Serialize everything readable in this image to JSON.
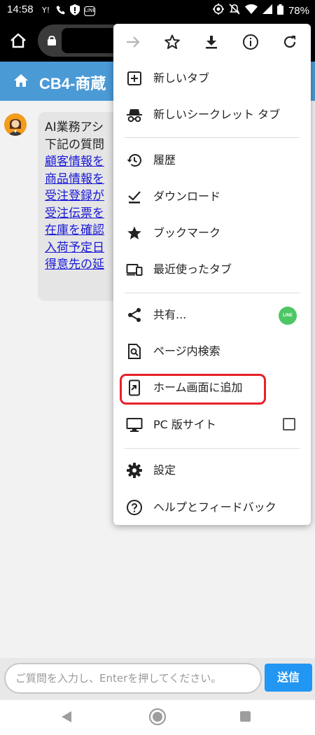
{
  "status_bar": {
    "time": "14:58",
    "left_icons": [
      "carrier-icon",
      "call-icon",
      "shield-alert-icon",
      "line-notification-icon"
    ],
    "right_icons": [
      "location-sync-icon",
      "mute-icon",
      "wifi-icon",
      "signal-icon",
      "battery-icon"
    ],
    "battery": "78%",
    "line_text": "LINE"
  },
  "browser": {
    "home_icon": "home-icon",
    "lock_icon": "lock-icon"
  },
  "app": {
    "title": "CB4-商蔵",
    "header_icon": "home-icon",
    "header_color": "#4a9ad6"
  },
  "chat": {
    "avatar": "assistant-avatar",
    "intro_lines": [
      "AI業務アシ",
      "下記の質問"
    ],
    "links": [
      "顧客情報を",
      "商品情報を",
      "受注登録が",
      "受注伝票を",
      "在庫を確認",
      "入荷予定日",
      "得意先の延"
    ]
  },
  "input": {
    "placeholder": "ご質問を入力し、Enterを押してください。",
    "send_label": "送信",
    "send_color": "#2196f3"
  },
  "menu": {
    "top_actions": [
      "forward-icon",
      "bookmark-star-icon",
      "download-icon",
      "info-icon",
      "reload-icon"
    ],
    "items": [
      {
        "icon": "new-tab-icon",
        "label": "新しいタブ"
      },
      {
        "icon": "incognito-icon",
        "label": "新しいシークレット タブ"
      },
      {
        "icon": "history-icon",
        "label": "履歴"
      },
      {
        "icon": "downloads-icon",
        "label": "ダウンロード"
      },
      {
        "icon": "bookmarks-icon",
        "label": "ブックマーク"
      },
      {
        "icon": "recent-tabs-icon",
        "label": "最近使ったタブ"
      },
      {
        "icon": "share-icon",
        "label": "共有..."
      },
      {
        "icon": "find-in-page-icon",
        "label": "ページ内検索"
      },
      {
        "icon": "add-to-home-icon",
        "label": "ホーム画面に追加"
      },
      {
        "icon": "desktop-site-icon",
        "label": "PC 版サイト"
      },
      {
        "icon": "settings-icon",
        "label": "設定"
      },
      {
        "icon": "help-icon",
        "label": "ヘルプとフィードバック"
      }
    ],
    "share_badge": "LINE",
    "desktop_site_checked": false,
    "highlight_color": "#e8202a"
  }
}
